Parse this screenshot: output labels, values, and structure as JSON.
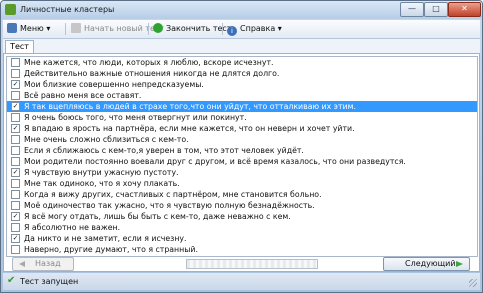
{
  "window": {
    "title": "Личностные кластеры",
    "buttons": {
      "minimize": "—",
      "maximize": "□",
      "close": "✕"
    }
  },
  "toolbar": {
    "menu_label": "Меню",
    "new_test_label": "Начать новый тест",
    "finish_label": "Закончить тест",
    "help_label": "Справка",
    "dropdown_glyph": "▾"
  },
  "tabs": [
    {
      "label": "Тест"
    }
  ],
  "list": {
    "items": [
      {
        "text": "Мне кажется, что люди, которых я люблю, вскоре исчезнут.",
        "checked": false
      },
      {
        "text": "Действительно важные отношения никогда не длятся долго.",
        "checked": false
      },
      {
        "text": "Мои близкие совершенно непредсказуемы.",
        "checked": true
      },
      {
        "text": "Всё равно меня все оставят.",
        "checked": false
      },
      {
        "text": "Я так вцепляюсь в людей в страхе того,что они уйдут, что отталкиваю их этим.",
        "checked": true,
        "selected": true
      },
      {
        "text": "Я очень боюсь того, что меня отвергнут или покинут.",
        "checked": false
      },
      {
        "text": "Я впадаю в ярость на партнёра, если мне кажется, что он неверн и хочет уйти.",
        "checked": true
      },
      {
        "text": "Мне очень сложно сблизиться с кем-то.",
        "checked": false
      },
      {
        "text": "Если я сближаюсь с кем-то,я уверен в том, что этот человек уйдёт.",
        "checked": false
      },
      {
        "text": "Мои родители постоянно воевали друг с другом, и всё время казалось, что они разведутся.",
        "checked": false
      },
      {
        "text": "Я чувствую внутри ужасную пустоту.",
        "checked": true
      },
      {
        "text": "Мне так одиноко, что я хочу плакать.",
        "checked": false
      },
      {
        "text": "Когда я вижу других, счастливых с партнёром, мне становится больно.",
        "checked": false
      },
      {
        "text": "Моё одиночество так ужасно, что я чувствую полную безнадёжность.",
        "checked": false
      },
      {
        "text": "Я всё могу отдать, лишь бы быть с кем-то, даже неважно с кем.",
        "checked": true
      },
      {
        "text": "Я абсолютно не важен.",
        "checked": false
      },
      {
        "text": "Да никто и не заметит, если я исчезну.",
        "checked": true
      },
      {
        "text": "Наверно, другие думают, что я странный.",
        "checked": false
      }
    ],
    "check_glyph": "✓"
  },
  "nav": {
    "back_label": "Назад",
    "next_label": "Следующий"
  },
  "status": {
    "text": "Тест запущен",
    "icon_glyph": "✔"
  },
  "colors": {
    "accent": "#3399ff",
    "ok_green": "#2f9e2f"
  },
  "icons": {
    "menu": "menu-icon",
    "new_test": "new-test-icon",
    "finish": "finish-icon",
    "help": "help-icon",
    "back": "back-arrow-icon",
    "next": "next-arrow-icon",
    "status": "check-status-icon"
  }
}
